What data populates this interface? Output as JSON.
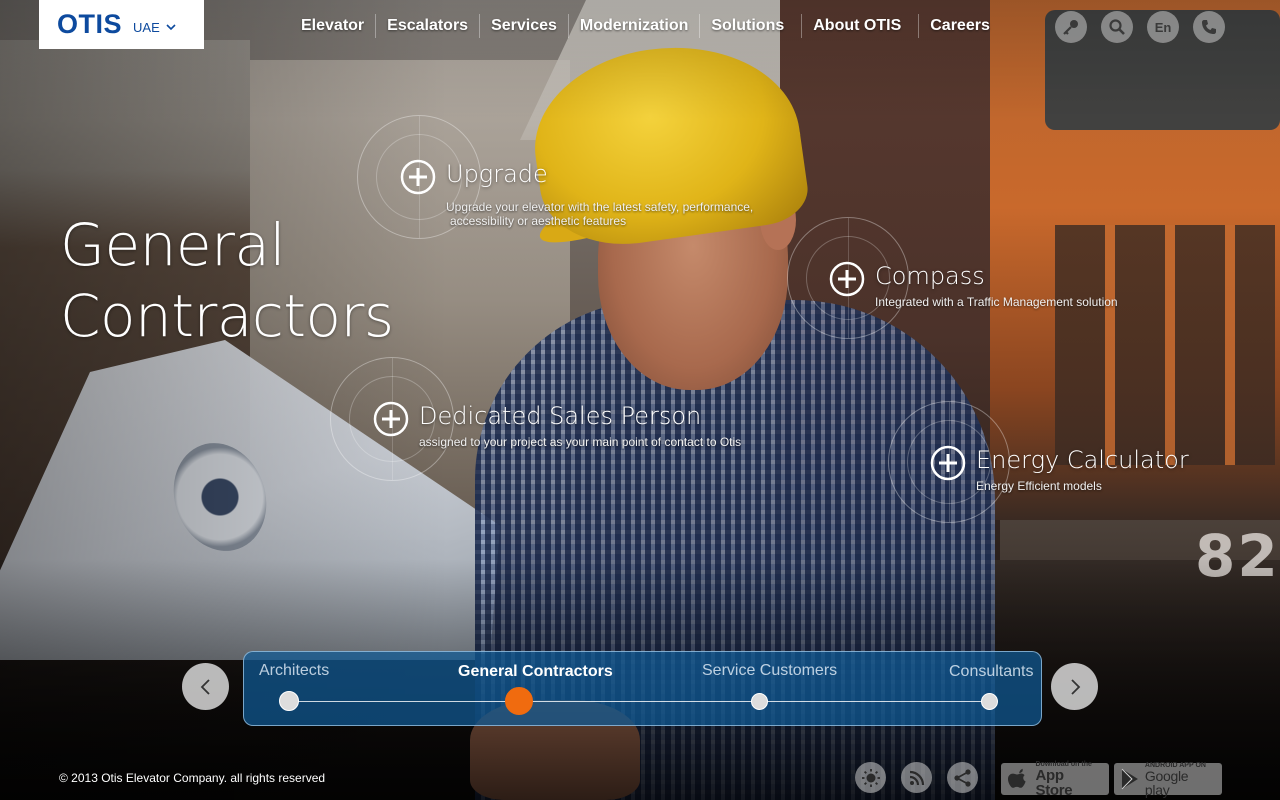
{
  "header": {
    "logo": "OTIS",
    "region": "UAE",
    "nav": [
      "Elevator",
      "Escalators",
      "Services",
      "Modernization",
      "Solutions",
      "About OTIS",
      "Careers"
    ],
    "icons": [
      "key-icon",
      "search-icon",
      "language-icon",
      "phone-icon"
    ],
    "language_label": "En"
  },
  "hero": {
    "title_line1": "General",
    "title_line2": "Contractors"
  },
  "features": [
    {
      "title": "Upgrade",
      "desc_line1": "Upgrade your elevator with the latest safety, performance,",
      "desc_line2": "accessibility or aesthetic features"
    },
    {
      "title": "Compass",
      "desc_line1": "Integrated with a Traffic Management solution",
      "desc_line2": ""
    },
    {
      "title": "Dedicated Sales Person",
      "desc_line1": "assigned to your project as your main point of contact to Otis",
      "desc_line2": ""
    },
    {
      "title": "Energy Calculator",
      "desc_line1": "Energy Efficient models",
      "desc_line2": ""
    }
  ],
  "slider": {
    "items": [
      "Architects",
      "General Contractors",
      "Service Customers",
      "Consultants"
    ],
    "active_index": 1,
    "accent": "#f06b0f"
  },
  "footer": {
    "copyright": "© 2013 Otis Elevator Company. all rights reserved",
    "social_icons": [
      "brightness-icon",
      "rss-icon",
      "share-icon"
    ],
    "app_store_small": "Download on the",
    "app_store_big": "App Store",
    "google_play_small": "ANDROID APP ON",
    "google_play_big": "Google play"
  },
  "colors": {
    "brand_blue": "#0d4a9e",
    "slider_bg": "#0f5a96",
    "active_dot": "#f06b0f"
  }
}
